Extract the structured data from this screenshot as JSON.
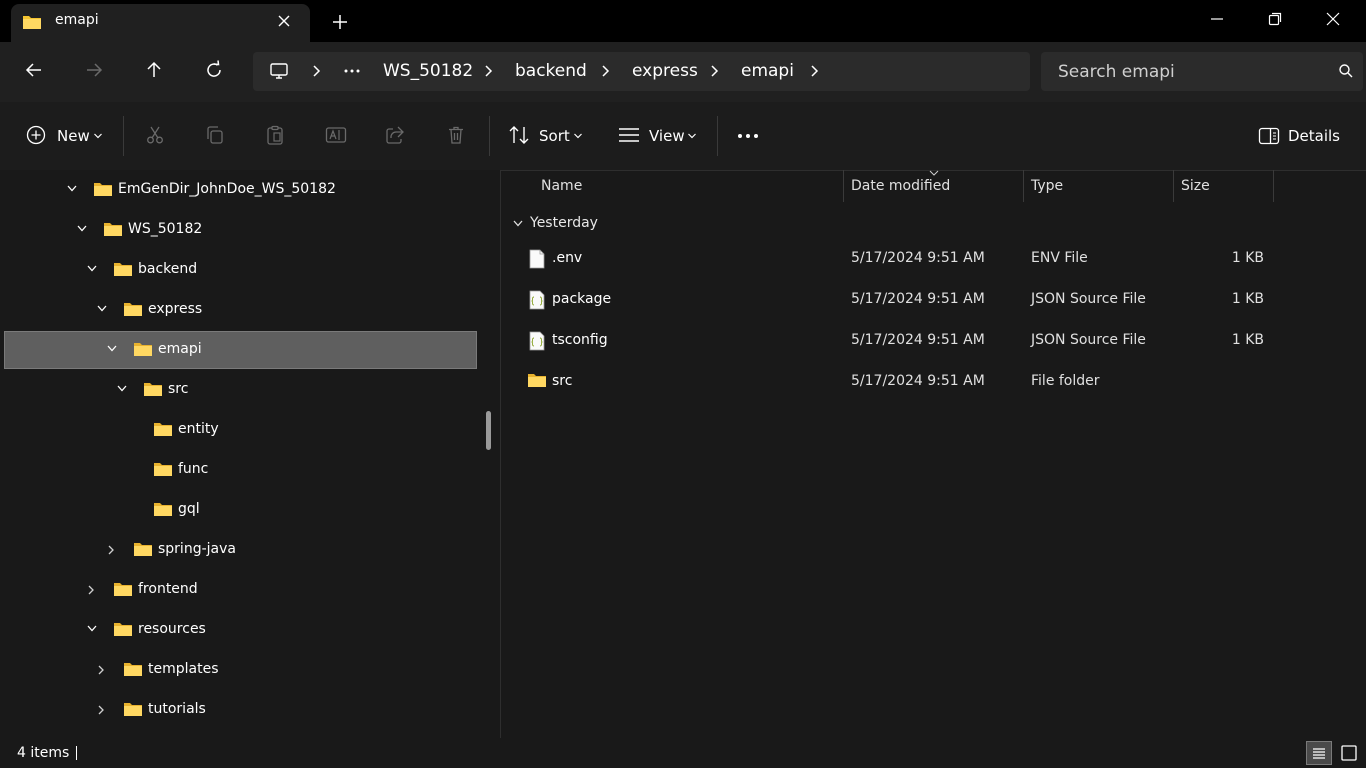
{
  "window": {
    "tab_title": "emapi"
  },
  "address": {
    "crumbs": [
      "WS_50182",
      "backend",
      "express",
      "emapi"
    ]
  },
  "search": {
    "placeholder": "Search emapi"
  },
  "commandbar": {
    "new_label": "New",
    "sort_label": "Sort",
    "view_label": "View",
    "details_label": "Details"
  },
  "tree": [
    {
      "label": "EmGenDir_JohnDoe_WS_50182",
      "expanded": true
    },
    {
      "label": "WS_50182",
      "expanded": true
    },
    {
      "label": "backend",
      "expanded": true
    },
    {
      "label": "express",
      "expanded": true
    },
    {
      "label": "emapi",
      "expanded": true,
      "selected": true
    },
    {
      "label": "src",
      "expanded": true
    },
    {
      "label": "entity"
    },
    {
      "label": "func"
    },
    {
      "label": "gql"
    },
    {
      "label": "spring-java",
      "expanded": false
    },
    {
      "label": "frontend",
      "expanded": false
    },
    {
      "label": "resources",
      "expanded": true
    },
    {
      "label": "templates",
      "expanded": false
    },
    {
      "label": "tutorials",
      "expanded": false
    }
  ],
  "columns": {
    "name": "Name",
    "date": "Date modified",
    "type": "Type",
    "size": "Size"
  },
  "group": {
    "label": "Yesterday"
  },
  "files": [
    {
      "name": ".env",
      "date": "5/17/2024 9:51 AM",
      "type": "ENV File",
      "size": "1 KB",
      "icon": "file-icon"
    },
    {
      "name": "package",
      "date": "5/17/2024 9:51 AM",
      "type": "JSON Source File",
      "size": "1 KB",
      "icon": "json-file-icon"
    },
    {
      "name": "tsconfig",
      "date": "5/17/2024 9:51 AM",
      "type": "JSON Source File",
      "size": "1 KB",
      "icon": "json-file-icon"
    },
    {
      "name": "src",
      "date": "5/17/2024 9:51 AM",
      "type": "File folder",
      "size": "",
      "icon": "folder-icon"
    }
  ],
  "status": {
    "item_count": "4 items"
  }
}
